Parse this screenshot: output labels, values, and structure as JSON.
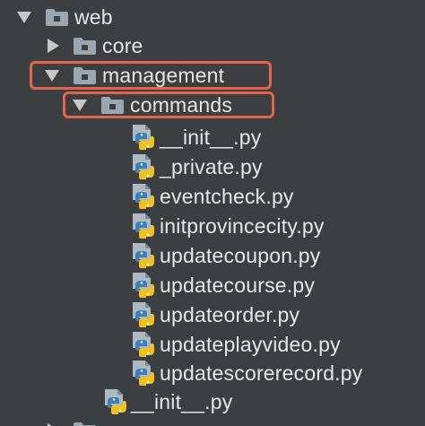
{
  "project_tree": {
    "root": {
      "label": "web"
    },
    "core": {
      "label": "core"
    },
    "management": {
      "label": "management"
    },
    "commands": {
      "label": "commands"
    },
    "command_files": [
      {
        "label": "__init__.py"
      },
      {
        "label": "_private.py"
      },
      {
        "label": "eventcheck.py"
      },
      {
        "label": "initprovincecity.py"
      },
      {
        "label": "updatecoupon.py"
      },
      {
        "label": "updatecourse.py"
      },
      {
        "label": "updateorder.py"
      },
      {
        "label": "updateplayvideo.py"
      },
      {
        "label": "updatescorerecord.py"
      }
    ],
    "management_init": {
      "label": "__init__.py"
    }
  },
  "colors": {
    "background": "#3c3f41",
    "text": "#e6e6e6",
    "highlight_outline": "#e4654a",
    "folder": "#9aa7b0",
    "python_blue": "#3e7fb5",
    "python_yellow": "#f1c21b"
  },
  "icons": {
    "folder": "folder-icon",
    "python_file": "python-file-icon",
    "expanded": "chevron-down-icon",
    "collapsed": "chevron-right-icon"
  }
}
